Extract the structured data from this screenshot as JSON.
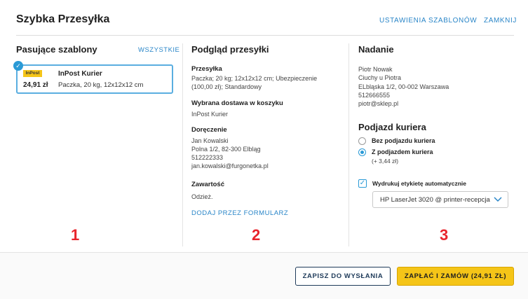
{
  "header": {
    "title": "Szybka Przesyłka",
    "settings_link": "USTAWIENIA SZABLONÓW",
    "close_link": "ZAMKNIJ"
  },
  "templates": {
    "title": "Pasujące szablony",
    "all_link": "WSZYSTKIE",
    "card": {
      "logo": "InPost",
      "name": "InPost Kurier",
      "price": "24,91 zł",
      "description": "Paczka, 20 kg, 12x12x12 cm"
    },
    "number": "1"
  },
  "preview": {
    "title": "Podgląd przesyłki",
    "parcel_label": "Przesyłka",
    "parcel_lines": [
      "Paczka; 20 kg; 12x12x12 cm; Ubezpieczenie",
      "(100,00 zł); Standardowy"
    ],
    "delivery_label": "Wybrana dostawa w koszyku",
    "delivery_value": "InPost Kurier",
    "recipient_label": "Doręczenie",
    "recipient_lines": [
      "Jan Kowalski",
      "Polna 1/2, 82-300 Elbląg",
      "512222333",
      "jan.kowalski@furgonetka.pl"
    ],
    "contents_label": "Zawartość",
    "contents_value": "Odzież.",
    "form_link": "DODAJ PRZEZ FORMULARZ",
    "number": "2"
  },
  "sender": {
    "title": "Nadanie",
    "lines": [
      "Piotr Nowak",
      "Ciuchy u Piotra",
      "ELbląska 1/2, 00-002 Warszawa",
      "512666555",
      "piotr@sklep.pl"
    ],
    "pickup_title": "Podjazd kuriera",
    "option_no_pickup": "Bez podjazdu kuriera",
    "option_pickup": "Z podjazdem kuriera",
    "option_pickup_price": "(+ 3,44 zł)",
    "print_label": "Wydrukuj etykietę automatycznie",
    "printer_value": "HP LaserJet 3020 @ printer-recepcja",
    "number": "3"
  },
  "footer": {
    "save_button": "ZAPISZ DO WYSŁANIA",
    "pay_button": "ZAPŁAĆ I ZAMÓW (24,91 ZŁ)"
  },
  "colors": {
    "accent": "#2a86c8",
    "primary_button": "#f5c518",
    "annotation": "#e8242c"
  }
}
